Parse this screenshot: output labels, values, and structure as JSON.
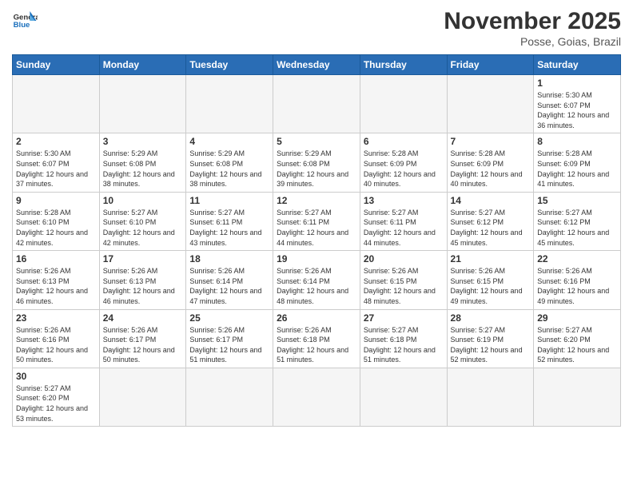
{
  "logo": {
    "general": "General",
    "blue": "Blue"
  },
  "header": {
    "month": "November 2025",
    "location": "Posse, Goias, Brazil"
  },
  "weekdays": [
    "Sunday",
    "Monday",
    "Tuesday",
    "Wednesday",
    "Thursday",
    "Friday",
    "Saturday"
  ],
  "weeks": [
    [
      {
        "day": "",
        "empty": true
      },
      {
        "day": "",
        "empty": true
      },
      {
        "day": "",
        "empty": true
      },
      {
        "day": "",
        "empty": true
      },
      {
        "day": "",
        "empty": true
      },
      {
        "day": "",
        "empty": true
      },
      {
        "day": "1",
        "sunrise": "5:30 AM",
        "sunset": "6:07 PM",
        "daylight": "12 hours and 36 minutes."
      }
    ],
    [
      {
        "day": "2",
        "sunrise": "5:30 AM",
        "sunset": "6:07 PM",
        "daylight": "12 hours and 37 minutes."
      },
      {
        "day": "3",
        "sunrise": "5:29 AM",
        "sunset": "6:08 PM",
        "daylight": "12 hours and 38 minutes."
      },
      {
        "day": "4",
        "sunrise": "5:29 AM",
        "sunset": "6:08 PM",
        "daylight": "12 hours and 38 minutes."
      },
      {
        "day": "5",
        "sunrise": "5:29 AM",
        "sunset": "6:08 PM",
        "daylight": "12 hours and 39 minutes."
      },
      {
        "day": "6",
        "sunrise": "5:28 AM",
        "sunset": "6:09 PM",
        "daylight": "12 hours and 40 minutes."
      },
      {
        "day": "7",
        "sunrise": "5:28 AM",
        "sunset": "6:09 PM",
        "daylight": "12 hours and 40 minutes."
      },
      {
        "day": "8",
        "sunrise": "5:28 AM",
        "sunset": "6:09 PM",
        "daylight": "12 hours and 41 minutes."
      }
    ],
    [
      {
        "day": "9",
        "sunrise": "5:28 AM",
        "sunset": "6:10 PM",
        "daylight": "12 hours and 42 minutes."
      },
      {
        "day": "10",
        "sunrise": "5:27 AM",
        "sunset": "6:10 PM",
        "daylight": "12 hours and 42 minutes."
      },
      {
        "day": "11",
        "sunrise": "5:27 AM",
        "sunset": "6:11 PM",
        "daylight": "12 hours and 43 minutes."
      },
      {
        "day": "12",
        "sunrise": "5:27 AM",
        "sunset": "6:11 PM",
        "daylight": "12 hours and 44 minutes."
      },
      {
        "day": "13",
        "sunrise": "5:27 AM",
        "sunset": "6:11 PM",
        "daylight": "12 hours and 44 minutes."
      },
      {
        "day": "14",
        "sunrise": "5:27 AM",
        "sunset": "6:12 PM",
        "daylight": "12 hours and 45 minutes."
      },
      {
        "day": "15",
        "sunrise": "5:27 AM",
        "sunset": "6:12 PM",
        "daylight": "12 hours and 45 minutes."
      }
    ],
    [
      {
        "day": "16",
        "sunrise": "5:26 AM",
        "sunset": "6:13 PM",
        "daylight": "12 hours and 46 minutes."
      },
      {
        "day": "17",
        "sunrise": "5:26 AM",
        "sunset": "6:13 PM",
        "daylight": "12 hours and 46 minutes."
      },
      {
        "day": "18",
        "sunrise": "5:26 AM",
        "sunset": "6:14 PM",
        "daylight": "12 hours and 47 minutes."
      },
      {
        "day": "19",
        "sunrise": "5:26 AM",
        "sunset": "6:14 PM",
        "daylight": "12 hours and 48 minutes."
      },
      {
        "day": "20",
        "sunrise": "5:26 AM",
        "sunset": "6:15 PM",
        "daylight": "12 hours and 48 minutes."
      },
      {
        "day": "21",
        "sunrise": "5:26 AM",
        "sunset": "6:15 PM",
        "daylight": "12 hours and 49 minutes."
      },
      {
        "day": "22",
        "sunrise": "5:26 AM",
        "sunset": "6:16 PM",
        "daylight": "12 hours and 49 minutes."
      }
    ],
    [
      {
        "day": "23",
        "sunrise": "5:26 AM",
        "sunset": "6:16 PM",
        "daylight": "12 hours and 50 minutes."
      },
      {
        "day": "24",
        "sunrise": "5:26 AM",
        "sunset": "6:17 PM",
        "daylight": "12 hours and 50 minutes."
      },
      {
        "day": "25",
        "sunrise": "5:26 AM",
        "sunset": "6:17 PM",
        "daylight": "12 hours and 51 minutes."
      },
      {
        "day": "26",
        "sunrise": "5:26 AM",
        "sunset": "6:18 PM",
        "daylight": "12 hours and 51 minutes."
      },
      {
        "day": "27",
        "sunrise": "5:27 AM",
        "sunset": "6:18 PM",
        "daylight": "12 hours and 51 minutes."
      },
      {
        "day": "28",
        "sunrise": "5:27 AM",
        "sunset": "6:19 PM",
        "daylight": "12 hours and 52 minutes."
      },
      {
        "day": "29",
        "sunrise": "5:27 AM",
        "sunset": "6:20 PM",
        "daylight": "12 hours and 52 minutes."
      }
    ],
    [
      {
        "day": "30",
        "sunrise": "5:27 AM",
        "sunset": "6:20 PM",
        "daylight": "12 hours and 53 minutes."
      },
      {
        "day": "",
        "empty": true
      },
      {
        "day": "",
        "empty": true
      },
      {
        "day": "",
        "empty": true
      },
      {
        "day": "",
        "empty": true
      },
      {
        "day": "",
        "empty": true
      },
      {
        "day": "",
        "empty": true
      }
    ]
  ]
}
